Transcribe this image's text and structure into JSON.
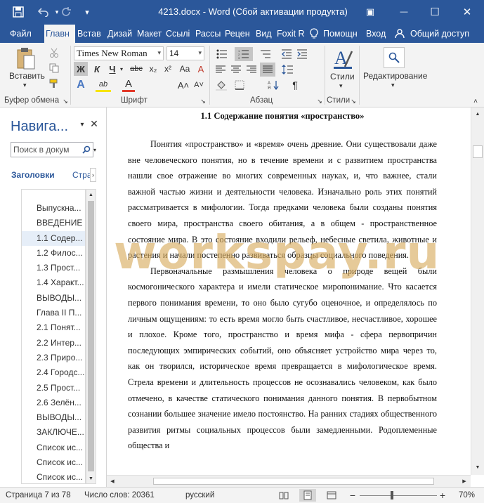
{
  "window": {
    "title": "4213.docx - Word (Сбой активации продукта)",
    "qat_save_icon": "save-icon",
    "qat_undo_icon": "undo-icon",
    "qat_redo_icon": "redo-icon",
    "customize_icon": "▾",
    "ribbon_display_icon": "▣",
    "minimize_icon": "—",
    "maximize_icon": "☐",
    "close_icon": "✕"
  },
  "tabs": [
    "Файл",
    "Главн",
    "Встав",
    "Дизай",
    "Макет",
    "Ссылі",
    "Рассы",
    "Рецен",
    "Вид",
    "Foxit R"
  ],
  "tell_me": "Помощн",
  "signin": "Вход",
  "share": "Общий доступ",
  "ribbon": {
    "clipboard": {
      "paste_label": "Вставить",
      "group": "Буфер обмена"
    },
    "font": {
      "name": "Times New Roman",
      "size": "14",
      "bold": "Ж",
      "italic": "К",
      "underline": "Ч",
      "strike": "abc",
      "subscript": "x₂",
      "superscript": "x²",
      "effects": "A",
      "highlight": "ab",
      "color": "A",
      "grow": "A˄",
      "shrink": "A˅",
      "case": "Aa",
      "clear": "A",
      "group": "Шрифт"
    },
    "paragraph": {
      "group": "Абзац",
      "pilcrow": "¶"
    },
    "styles": {
      "label": "Стили",
      "group": "Стили"
    },
    "editing": {
      "label": "Редактирование"
    }
  },
  "nav": {
    "title": "Навига...",
    "search_placeholder": "Поиск в докум",
    "tab_headings": "Заголовки",
    "tab_pages": "Стра",
    "items": [
      "Выпускна...",
      "ВВЕДЕНИЕ",
      "1.1 Содер...",
      "1.2 Филос...",
      "1.3 Прост...",
      "1.4 Характ...",
      "ВЫВОДЫ...",
      "Глава II П...",
      "2.1 Понят...",
      "2.2 Интер...",
      "2.3 Приро...",
      "2.4 Городс...",
      "2.5 Прост...",
      "2.6 Зелён...",
      "ВЫВОДЫ...",
      "ЗАКЛЮЧЕ...",
      "Список ис...",
      "Список ис...",
      "Список ис..."
    ]
  },
  "document": {
    "heading": "1.1 Содержание понятия «пространство»",
    "paragraphs": [
      "Понятия «пространство» и «время» очень древние. Они существовали даже вне человеческого понятия, но в течение времени и с развитием пространства нашли свое отражение во многих современных науках, и, что важнее, стали важной частью жизни и деятельности человека. Изначально роль этих понятий рассматривается в мифологии. Тогда предками человека были созданы понятия своего мира, пространства своего обитания, а в общем - пространственное состояние мира. В это состояние входили рельеф, небесные светила, животные и растения и начали постепенно развиваться образцы социального поведения.",
      "Первоначальные размышления человека о природе вещей были космогонического характера и имели статическое миропонимание. Что касается первого понимания времени, то оно было сугубо оценочное, и определялось по личным ощущениям: то есть время могло быть счастливое, несчастливое, хорошее и плохое. Кроме того, пространство и время мифа - сфера первопричин последующих эмпирических событий, оно объясняет устройство мира через то, как он творился, историческое время превращается в мифологическое время. Стрела времени и длительность процессов не осознавались человеком, как было отмечено, в качестве статического понимания данного понятия. В первобытном сознании большее значение имело постоянство. На ранних стадиях общественного развития ритмы социальных процессов были замедленными. Родоплеменные общества и"
    ],
    "watermark": "workspay.ru"
  },
  "status": {
    "page": "Страница 7 из 78",
    "words": "Число слов: 20361",
    "language": "русский",
    "zoom": "70%"
  },
  "colors": {
    "accent": "#2b579a",
    "ribbon_bg": "#f3f3f3"
  }
}
